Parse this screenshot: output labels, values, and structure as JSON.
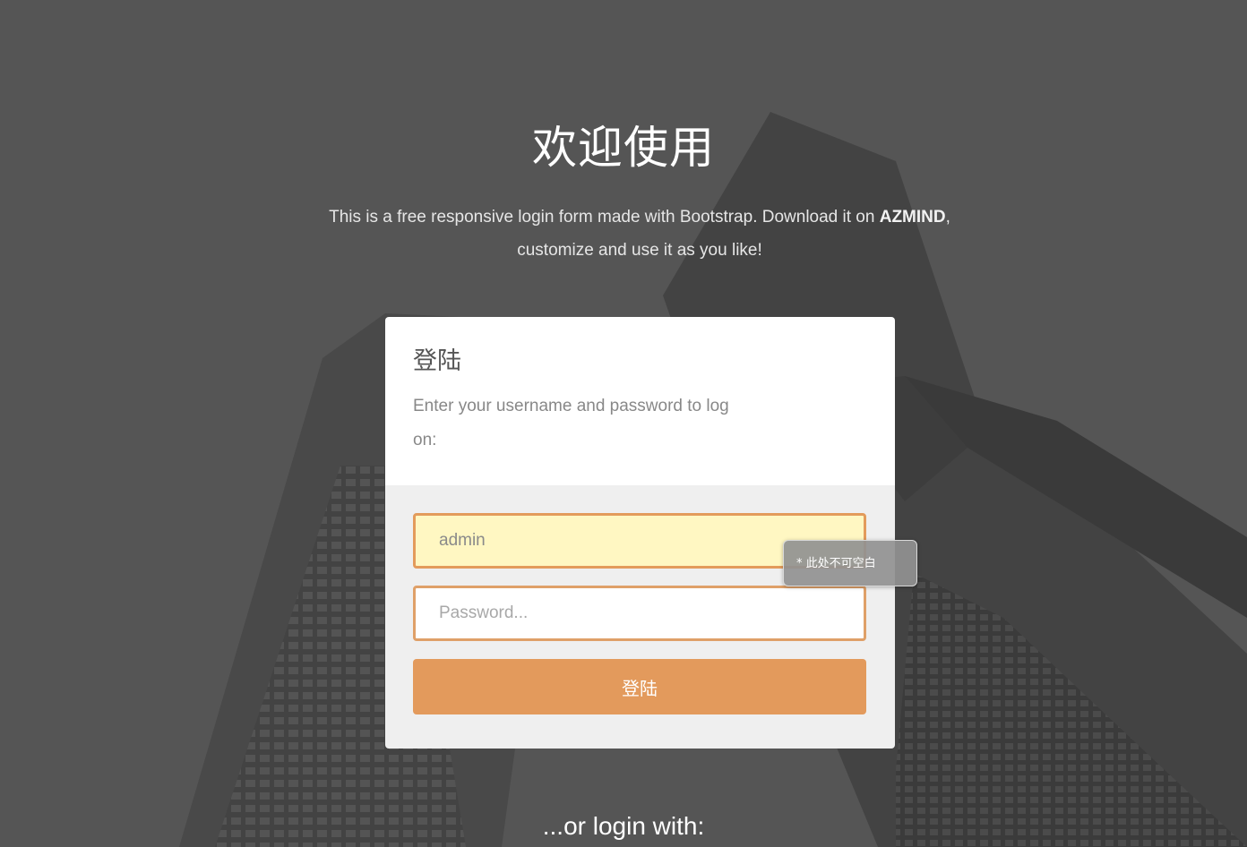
{
  "page": {
    "title": "欢迎使用",
    "intro_before": "This is a free responsive login form made with Bootstrap. Download it on ",
    "intro_brand": "AZMIND",
    "intro_after": ", customize and use it as you like!"
  },
  "form": {
    "heading": "登陆",
    "description": "Enter your username and password to log on:",
    "username_value": "admin",
    "password_placeholder": "Password...",
    "submit_label": "登陆",
    "validation_tooltip": "* 此处不可空白"
  },
  "alternate": {
    "label": "...or login with:"
  },
  "colors": {
    "accent": "#e39a5c",
    "input_highlight": "#fff7c2",
    "overlay": "#4f4f4f"
  }
}
